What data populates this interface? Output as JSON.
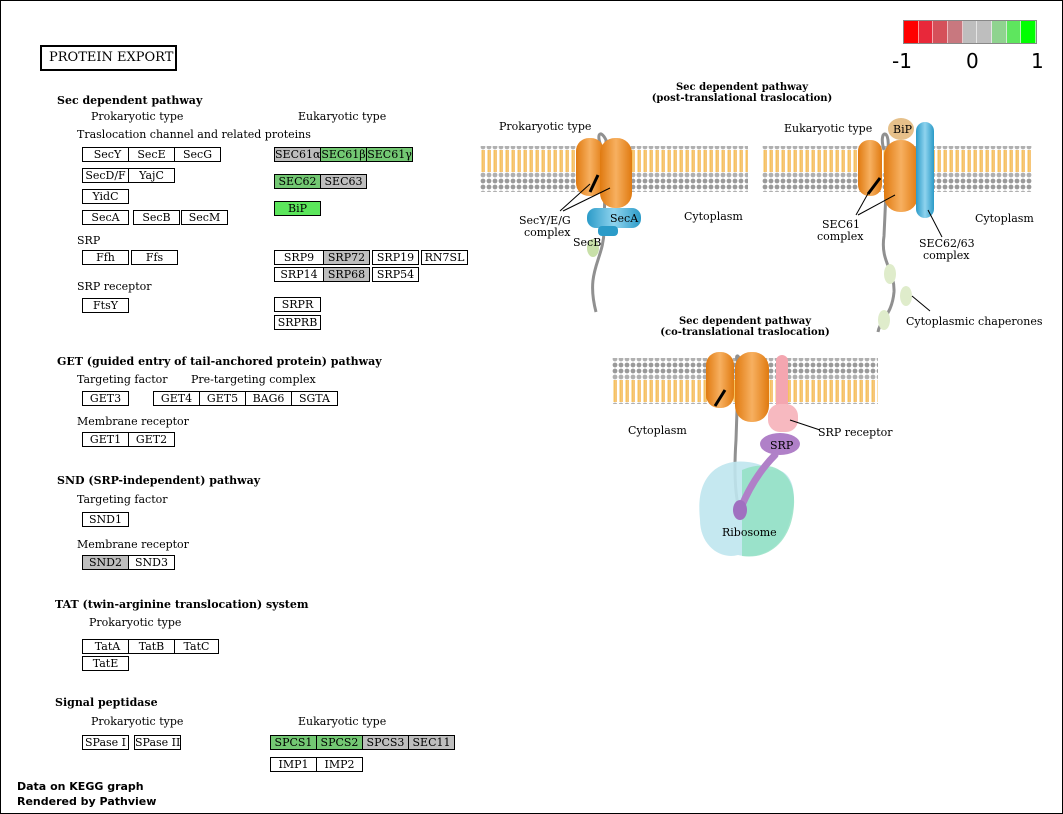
{
  "title": "PROTEIN EXPORT",
  "legend": {
    "min": "-1",
    "mid": "0",
    "max": "1",
    "colors": [
      "#ff0000",
      "#e8283a",
      "#d5505a",
      "#c8787f",
      "#bebebe",
      "#bebebe",
      "#8fd38f",
      "#5ee65e",
      "#00ff00"
    ]
  },
  "sections": {
    "sec": "Sec dependent pathway",
    "get": "GET (guided entry of tail-anchored protein) pathway",
    "snd": "SND (SRP-independent) pathway",
    "tat": "TAT (twin-arginine translocation) system",
    "sp": "Signal peptidase"
  },
  "labels": {
    "prok": "Prokaryotic type",
    "euk": "Eukaryotic type",
    "transloc": "Traslocation channel and related proteins",
    "srp": "SRP",
    "srp_receptor": "SRP receptor",
    "targeting": "Targeting factor",
    "pretargeting": "Pre-targeting complex",
    "membrane_receptor": "Membrane receptor"
  },
  "genes": {
    "SecY": "SecY",
    "SecE": "SecE",
    "SecG": "SecG",
    "SecDF": "SecD/F",
    "YajC": "YajC",
    "YidC": "YidC",
    "SecA": "SecA",
    "SecB": "SecB",
    "SecM": "SecM",
    "Ffh": "Ffh",
    "Ffs": "Ffs",
    "FtsY": "FtsY",
    "SEC61a": "SEC61α",
    "SEC61b": "SEC61β",
    "SEC61g": "SEC61γ",
    "SEC62": "SEC62",
    "SEC63": "SEC63",
    "BiP": "BiP",
    "SRP9": "SRP9",
    "SRP72": "SRP72",
    "SRP19": "SRP19",
    "RN7SL": "RN7SL",
    "SRP14": "SRP14",
    "SRP68": "SRP68",
    "SRP54": "SRP54",
    "SRPR": "SRPR",
    "SRPRB": "SRPRB",
    "GET3": "GET3",
    "GET4": "GET4",
    "GET5": "GET5",
    "BAG6": "BAG6",
    "SGTA": "SGTA",
    "GET1": "GET1",
    "GET2": "GET2",
    "SND1": "SND1",
    "SND2": "SND2",
    "SND3": "SND3",
    "TatA": "TatA",
    "TatB": "TatB",
    "TatC": "TatC",
    "TatE": "TatE",
    "SPaseI": "SPase I",
    "SPaseII": "SPase II",
    "SPCS1": "SPCS1",
    "SPCS2": "SPCS2",
    "SPCS3": "SPCS3",
    "SEC11": "SEC11",
    "IMP1": "IMP1",
    "IMP2": "IMP2"
  },
  "diagram": {
    "post_title1": "Sec dependent pathway",
    "post_title2": "(post-translational traslocation)",
    "co_title1": "Sec dependent pathway",
    "co_title2": "(co-translational traslocation)",
    "prok": "Prokaryotic type",
    "euk": "Eukaryotic type",
    "bip": "BiP",
    "secyeg1": "SecY/E/G",
    "secyeg2": "complex",
    "seca": "SecA",
    "secb": "SecB",
    "cytoplasm": "Cytoplasm",
    "sec61_1": "SEC61",
    "sec61_2": "complex",
    "sec6263_1": "SEC62/63",
    "sec6263_2": "complex",
    "chaperones": "Cytoplasmic chaperones",
    "srp_receptor": "SRP receptor",
    "srp": "SRP",
    "ribosome": "Ribosome"
  },
  "footer": {
    "line1": "Data on KEGG graph",
    "line2": "Rendered by Pathview"
  }
}
